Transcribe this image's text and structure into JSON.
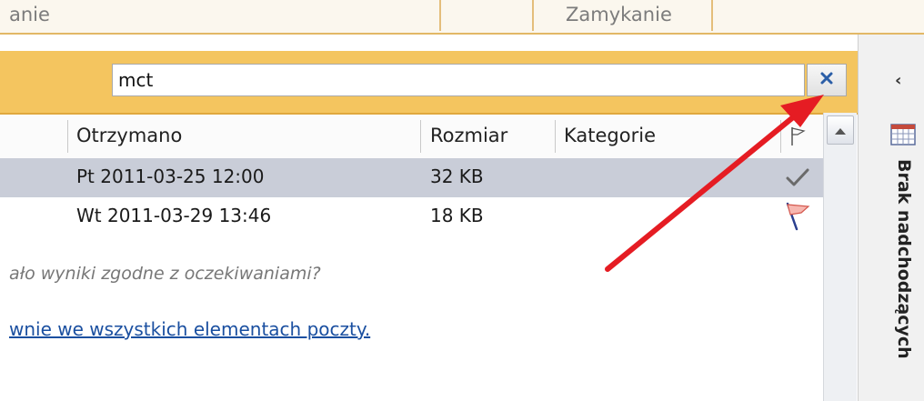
{
  "ribbon": {
    "left_text": "anie",
    "right_text": "Zamykanie"
  },
  "search": {
    "query": "mct"
  },
  "columns": {
    "received": "Otrzymano",
    "size": "Rozmiar",
    "categories": "Kategorie"
  },
  "rows": [
    {
      "received": "Pt 2011-03-25 12:00",
      "size": "32 KB",
      "status_icon": "check-icon"
    },
    {
      "received": "Wt 2011-03-29 13:46",
      "size": "18 KB",
      "status_icon": "flag-icon"
    }
  ],
  "results_note": "ało wyniki zgodne z oczekiwaniami?",
  "search_all_link": "wnie we wszystkich elementach poczty.",
  "todo_bar": {
    "label": "Brak nadchodzących",
    "collapse_glyph": "‹"
  },
  "colors": {
    "search_bar": "#f4c55f",
    "selected_row": "#c9cdd8",
    "link": "#1a4fa0",
    "arrow": "#e51c23"
  }
}
